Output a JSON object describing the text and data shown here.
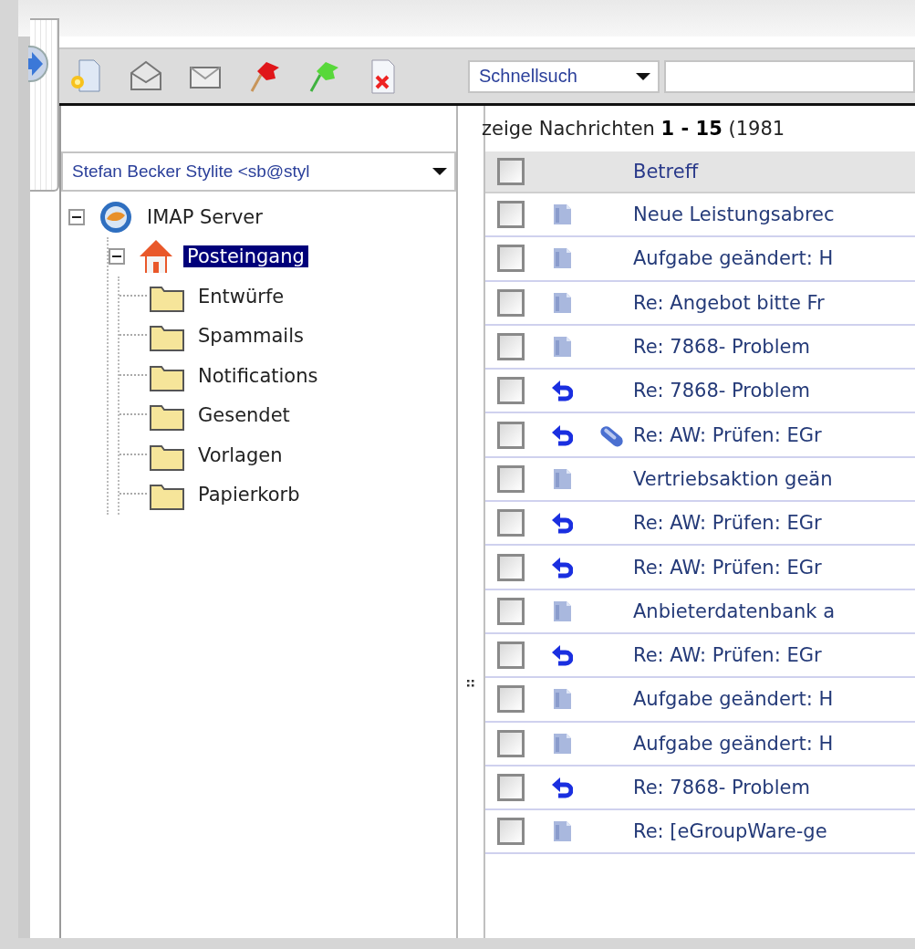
{
  "quick_search": {
    "value": "Schnellsuch"
  },
  "account_select": {
    "value": "Stefan Becker Stylite <sb@styl"
  },
  "folder_tree": [
    {
      "label": "IMAP Server",
      "kind": "server",
      "expanded": true,
      "selected": false,
      "children": [
        {
          "label": "Posteingang",
          "kind": "inbox",
          "expanded": true,
          "selected": true,
          "children": [
            {
              "label": "Entwürfe",
              "kind": "folder",
              "selected": false
            },
            {
              "label": "Spammails",
              "kind": "folder",
              "selected": false
            },
            {
              "label": "Notifications",
              "kind": "folder",
              "selected": false
            },
            {
              "label": "Gesendet",
              "kind": "folder",
              "selected": false
            },
            {
              "label": "Vorlagen",
              "kind": "folder",
              "selected": false
            },
            {
              "label": "Papierkorb",
              "kind": "folder",
              "selected": false
            }
          ]
        }
      ]
    }
  ],
  "message_list": {
    "summary": "zeige Nachrichten **1 - 15** (1981",
    "select_all_checked": false,
    "columns": [
      {
        "label": "Betreff"
      }
    ],
    "rows": [
      {
        "subject": "Neue Leistungsabrec",
        "kind": "read",
        "attachment": false,
        "checked": false
      },
      {
        "subject": "Aufgabe geändert: H",
        "kind": "read",
        "attachment": false,
        "checked": false
      },
      {
        "subject": "Re: Angebot bitte Fr",
        "kind": "read",
        "attachment": false,
        "checked": false
      },
      {
        "subject": "Re: 7868- Problem",
        "kind": "read",
        "attachment": false,
        "checked": false
      },
      {
        "subject": "Re: 7868- Problem",
        "kind": "answered",
        "attachment": false,
        "checked": false
      },
      {
        "subject": "Re: AW: Prüfen: EGr",
        "kind": "answered",
        "attachment": true,
        "checked": false
      },
      {
        "subject": "Vertriebsaktion geän",
        "kind": "read",
        "attachment": false,
        "checked": false
      },
      {
        "subject": "Re: AW: Prüfen: EGr",
        "kind": "answered",
        "attachment": false,
        "checked": false
      },
      {
        "subject": "Re: AW: Prüfen: EGr",
        "kind": "answered",
        "attachment": false,
        "checked": false
      },
      {
        "subject": "Anbieterdatenbank a",
        "kind": "read",
        "attachment": false,
        "checked": false
      },
      {
        "subject": "Re: AW: Prüfen: EGr",
        "kind": "answered",
        "attachment": false,
        "checked": false
      },
      {
        "subject": "Aufgabe geändert: H",
        "kind": "read",
        "attachment": false,
        "checked": false
      },
      {
        "subject": "Aufgabe geändert: H",
        "kind": "read",
        "attachment": false,
        "checked": false
      },
      {
        "subject": "Re: 7868- Problem",
        "kind": "answered",
        "attachment": false,
        "checked": false
      },
      {
        "subject": "Re: [eGroupWare-ge",
        "kind": "read",
        "attachment": false,
        "checked": false
      }
    ]
  }
}
